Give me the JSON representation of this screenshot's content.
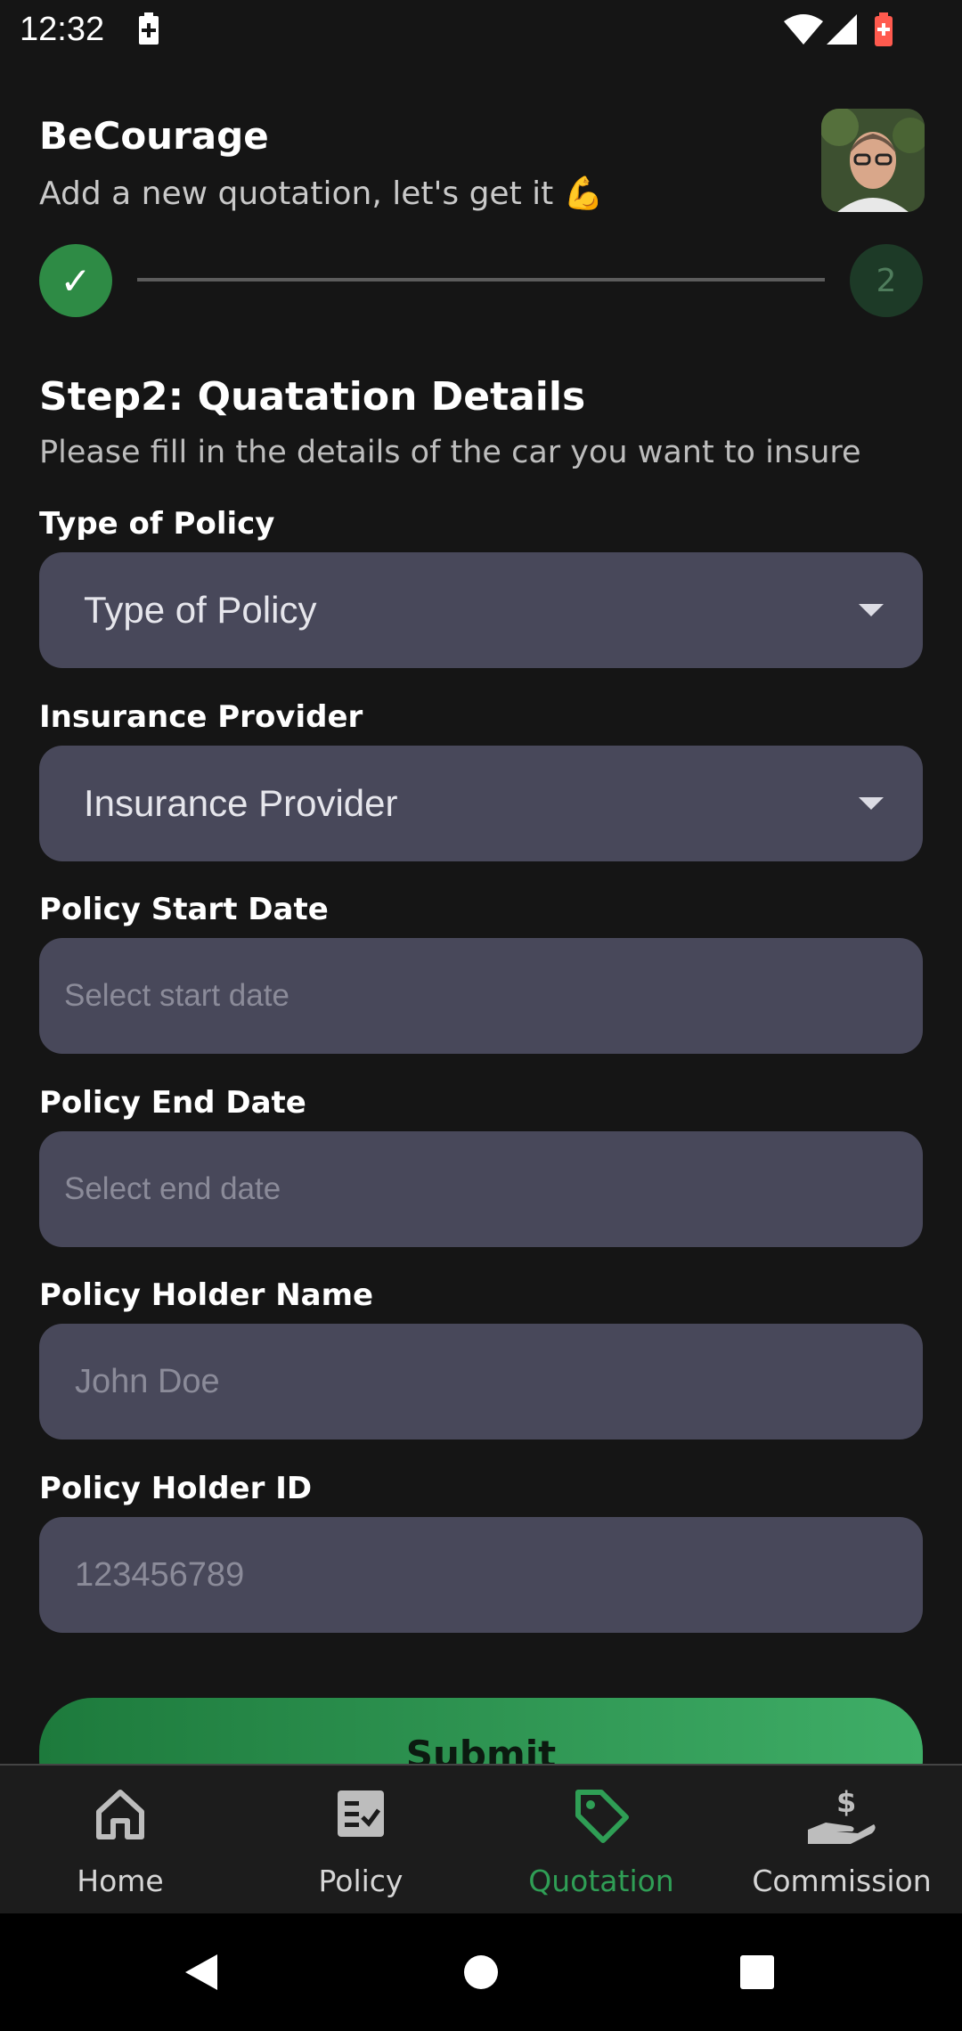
{
  "status_bar": {
    "time": "12:32"
  },
  "header": {
    "title": "BeCourage",
    "subtitle": "Add a new quotation, let's get it 💪"
  },
  "stepper": {
    "step1_mark": "✓",
    "step2_label": "2"
  },
  "section": {
    "title": "Step2: Quatation Details",
    "description": "Please fill in the details of the car you want to insure"
  },
  "form": {
    "policy_type": {
      "label": "Type of Policy",
      "value": "Type of Policy"
    },
    "provider": {
      "label": "Insurance Provider",
      "value": "Insurance Provider"
    },
    "start_date": {
      "label": "Policy Start Date",
      "placeholder": "Select start date"
    },
    "end_date": {
      "label": "Policy End Date",
      "placeholder": "Select end date"
    },
    "holder_name": {
      "label": "Policy Holder Name",
      "placeholder": "John Doe"
    },
    "holder_id": {
      "label": "Policy Holder ID",
      "placeholder": "123456789"
    },
    "submit_label": "Submit"
  },
  "bottom_nav": {
    "items": [
      {
        "label": "Home",
        "icon": "home-icon"
      },
      {
        "label": "Policy",
        "icon": "policy-icon"
      },
      {
        "label": "Quotation",
        "icon": "tag-icon",
        "active": true
      },
      {
        "label": "Commission",
        "icon": "hand-dollar-icon"
      }
    ]
  },
  "colors": {
    "accent": "#2f9e55",
    "field_bg": "#48485a",
    "background": "#151515"
  }
}
